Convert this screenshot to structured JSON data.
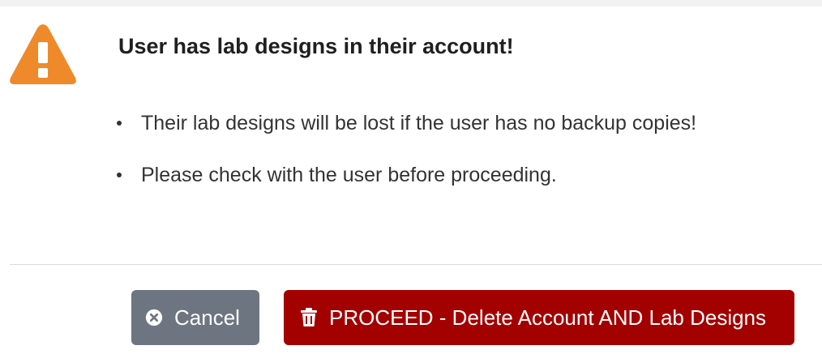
{
  "dialog": {
    "title": "User has lab designs in their account!",
    "bullets": [
      "Their lab designs will be lost if the user has no backup copies!",
      "Please check with the user before proceeding."
    ],
    "icon": "warning-triangle-icon",
    "accent_color": "#ee8a2a"
  },
  "buttons": {
    "cancel_label": "Cancel",
    "cancel_icon": "close-circle-icon",
    "cancel_color": "#6d7680",
    "proceed_label": "PROCEED - Delete Account AND Lab Designs",
    "proceed_icon": "trash-icon",
    "proceed_color": "#a30000"
  }
}
